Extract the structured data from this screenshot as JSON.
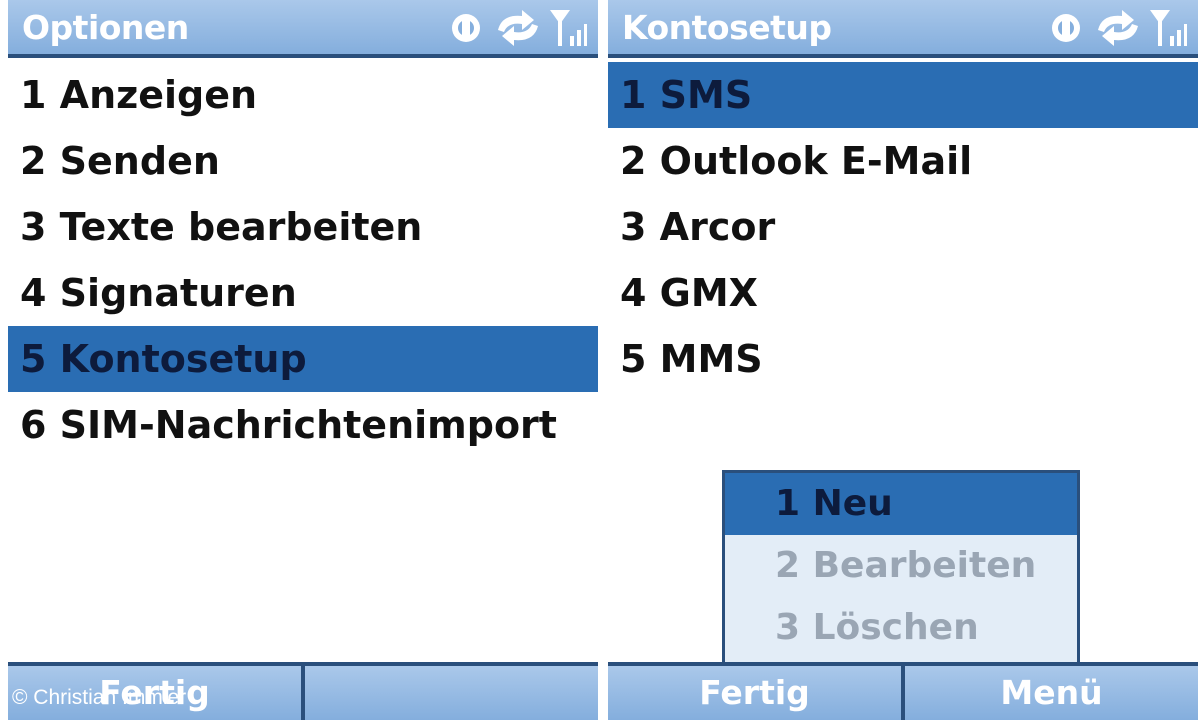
{
  "left": {
    "title": "Optionen",
    "items": [
      "1 Anzeigen",
      "2 Senden",
      "3 Texte bearbeiten",
      "4 Signaturen",
      "5 Kontosetup",
      "6 SIM-Nachrichtenimport"
    ],
    "selected_index": 4,
    "softkeys": [
      "Fertig",
      ""
    ]
  },
  "right": {
    "title": "Kontosetup",
    "items": [
      "1 SMS",
      "2 Outlook E-Mail",
      "3 Arcor",
      "4 GMX",
      "5 MMS"
    ],
    "selected_index": 0,
    "popup": {
      "items": [
        "1 Neu",
        "2 Bearbeiten",
        "3 Löschen"
      ],
      "selected_index": 0
    },
    "softkeys": [
      "Fertig",
      "Menü"
    ]
  },
  "status_icons": [
    "sync-globe-icon",
    "connection-arrows-icon",
    "signal-strength-icon"
  ],
  "copyright": "© Christian Immler",
  "colors": {
    "titlebar": "#84aedd",
    "selection": "#2a6db3",
    "border": "#2a4f7c"
  }
}
